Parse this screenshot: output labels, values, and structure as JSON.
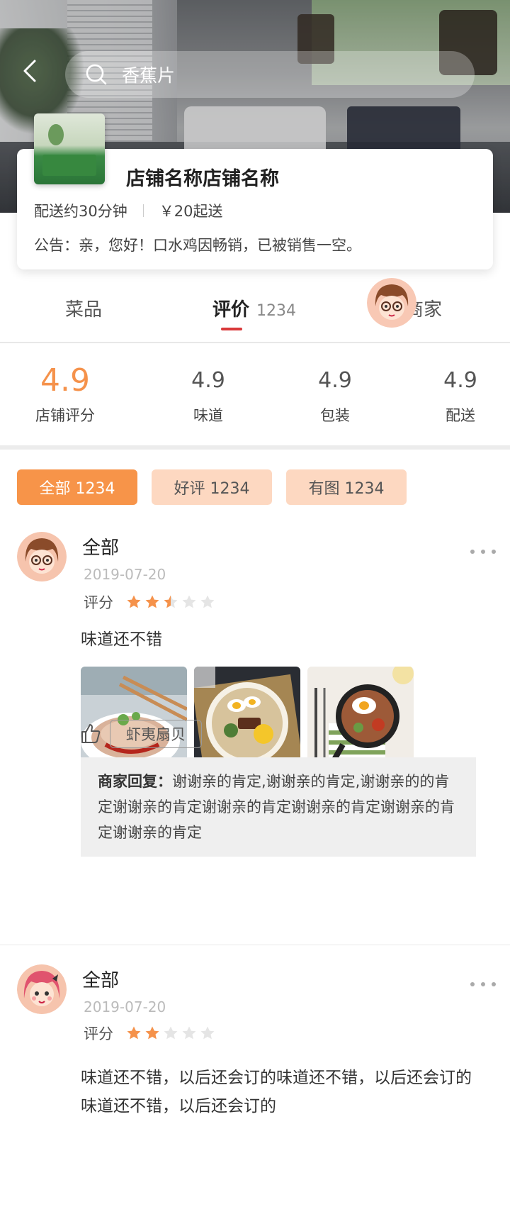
{
  "header": {
    "search_text": "香蕉片"
  },
  "store": {
    "name": "店铺名称店铺名称",
    "delivery_time": "配送约30分钟",
    "min_order": "￥20起送",
    "notice": "公告：亲，您好！口水鸡因畅销，已被销售一空。"
  },
  "tabs": {
    "dishes": "菜品",
    "reviews": "评价",
    "reviews_count": "1234",
    "merchant": "商家"
  },
  "ratings": {
    "overall_value": "4.9",
    "overall_label": "店铺评分",
    "taste_value": "4.9",
    "taste_label": "味道",
    "packaging_value": "4.9",
    "packaging_label": "包装",
    "delivery_value": "4.9",
    "delivery_label": "配送"
  },
  "filters": {
    "all": "全部 1234",
    "good": "好评 1234",
    "with_images": "有图 1234"
  },
  "reviews": [
    {
      "name": "全部",
      "date": "2019-07-20",
      "score_label": "评分",
      "rating": 2.5,
      "text": "味道还不错",
      "tag": "虾夷扇贝",
      "reply_label": "商家回复：",
      "reply_text": "谢谢亲的肯定,谢谢亲的肯定,谢谢亲的的肯定谢谢亲的肯定谢谢亲的肯定谢谢亲的肯定谢谢亲的肯定谢谢亲的肯定"
    },
    {
      "name": "全部",
      "date": "2019-07-20",
      "score_label": "评分",
      "rating": 2,
      "text": "味道还不错，以后还会订的味道还不错，以后还会订的味道还不错，以后还会订的"
    }
  ],
  "colors": {
    "accent": "#f79449",
    "accent_light": "#fdd8c1",
    "tab_underline": "#d9393a",
    "star_on": "#f5924b",
    "star_off": "#e5e5e5"
  }
}
